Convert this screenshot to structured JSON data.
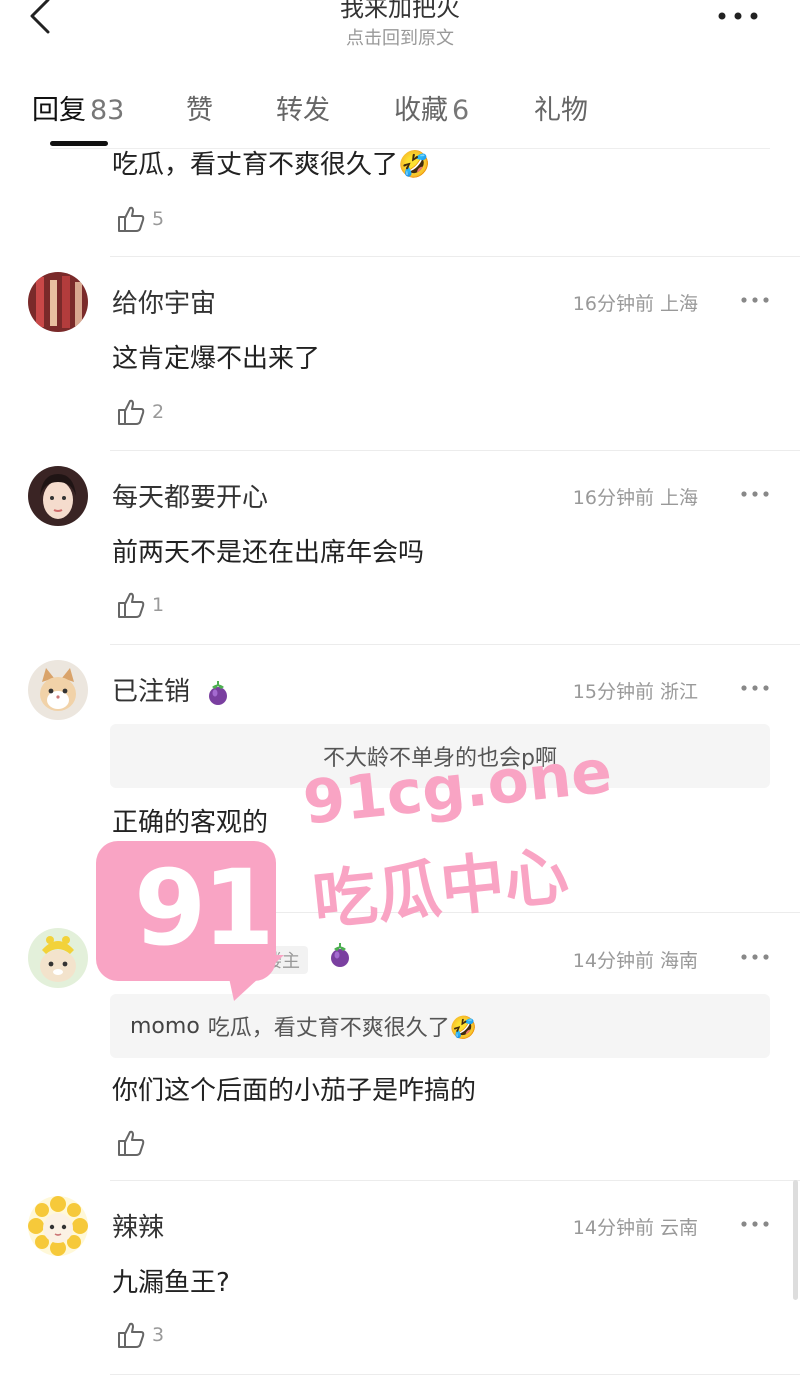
{
  "header": {
    "title": "我来加把火",
    "subtitle": "点击回到原文"
  },
  "tabs": [
    {
      "label": "回复",
      "count": "83",
      "active": true
    },
    {
      "label": "赞",
      "count": ""
    },
    {
      "label": "转发",
      "count": ""
    },
    {
      "label": "收藏",
      "count": "6"
    },
    {
      "label": "礼物",
      "count": ""
    }
  ],
  "comments": [
    {
      "text": "吃瓜，看丈育不爽很久了🤣",
      "likes": "5"
    },
    {
      "username": "给你宇宙",
      "meta": "16分钟前 上海",
      "text": "这肯定爆不出来了",
      "likes": "2"
    },
    {
      "username": "每天都要开心",
      "meta": "16分钟前 上海",
      "text": "前两天不是还在出席年会吗",
      "likes": "1"
    },
    {
      "username": "已注销",
      "meta": "15分钟前 浙江",
      "quote": "不大龄不单身的也会p啊",
      "text": "正确的客观的",
      "likes": "1"
    },
    {
      "badge": "楼主",
      "meta": "14分钟前 海南",
      "quote_user": "momo",
      "quote": "吃瓜，看丈育不爽很久了🤣",
      "text": "你们这个后面的小茄子是咋搞的",
      "likes": ""
    },
    {
      "username": "辣辣",
      "meta": "14分钟前 云南",
      "text": "九漏鱼王?",
      "likes": "3"
    }
  ],
  "watermark": {
    "number": "91",
    "domain": "91cg.one",
    "name": "吃瓜中心"
  },
  "colors": {
    "watermark": "#f9a4c4",
    "eggplant": "#7a3fa0",
    "divider": "#ececec"
  }
}
